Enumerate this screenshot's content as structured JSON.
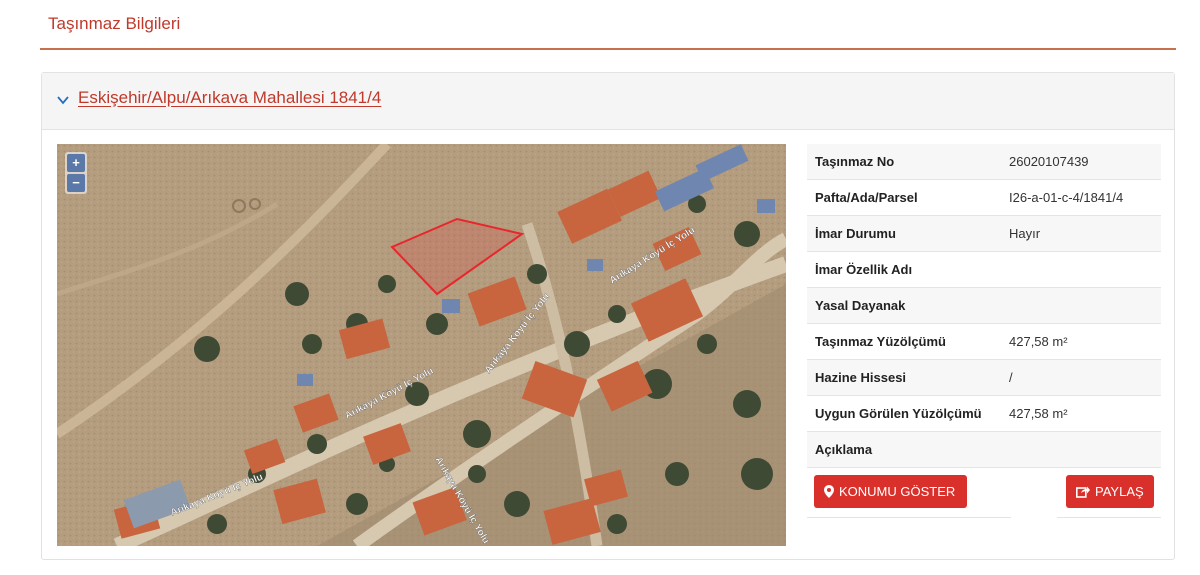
{
  "page": {
    "title": "Taşınmaz Bilgileri"
  },
  "panel": {
    "heading": "Eskişehir/Alpu/Arıkava Mahallesi 1841/4"
  },
  "map": {
    "zoom_in": "+",
    "zoom_out": "−",
    "road_labels": [
      "Arıkaya Köyü İç Yolu",
      "Arıkaya Köyü İç Yolu",
      "Arıkaya Köyü İç Yolu",
      "Arıkaya Köyü İç Yolu",
      "Arıkaya Köyü İç Yolu"
    ],
    "parcel_color": "#e8262b"
  },
  "info": {
    "rows": [
      {
        "label": "Taşınmaz No",
        "value": "26020107439"
      },
      {
        "label": "Pafta/Ada/Parsel",
        "value": "I26-a-01-c-4/1841/4"
      },
      {
        "label": "İmar Durumu",
        "value": "Hayır"
      },
      {
        "label": "İmar Özellik Adı",
        "value": ""
      },
      {
        "label": "Yasal Dayanak",
        "value": ""
      },
      {
        "label": "Taşınmaz Yüzölçümü",
        "value": "427,58 m²"
      },
      {
        "label": "Hazine Hissesi",
        "value": "/"
      },
      {
        "label": "Uygun Görülen Yüzölçümü",
        "value": "427,58 m²"
      },
      {
        "label": "Açıklama",
        "value": ""
      }
    ]
  },
  "buttons": {
    "show_location": "KONUMU GÖSTER",
    "share": "PAYLAŞ"
  },
  "colors": {
    "accent": "#c0392b",
    "button": "#d9302b"
  }
}
